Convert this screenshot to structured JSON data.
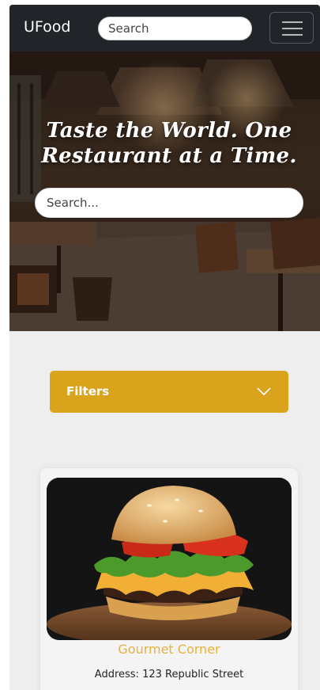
{
  "navbar": {
    "brand": "UFood",
    "search_placeholder": "Search"
  },
  "hero": {
    "title": "Taste the World. One Restaurant at a Time.",
    "search_placeholder": "Search..."
  },
  "filters": {
    "label": "Filters"
  },
  "restaurants": [
    {
      "name": "Gourmet Corner",
      "address": "Address: 123 Republic Street"
    }
  ],
  "colors": {
    "navbar": "#212529",
    "accent": "#d9a31c",
    "card_title": "#e8b23a"
  },
  "icons": {
    "menu": "hamburger-menu-icon",
    "filters": "chevron-down-icon"
  }
}
